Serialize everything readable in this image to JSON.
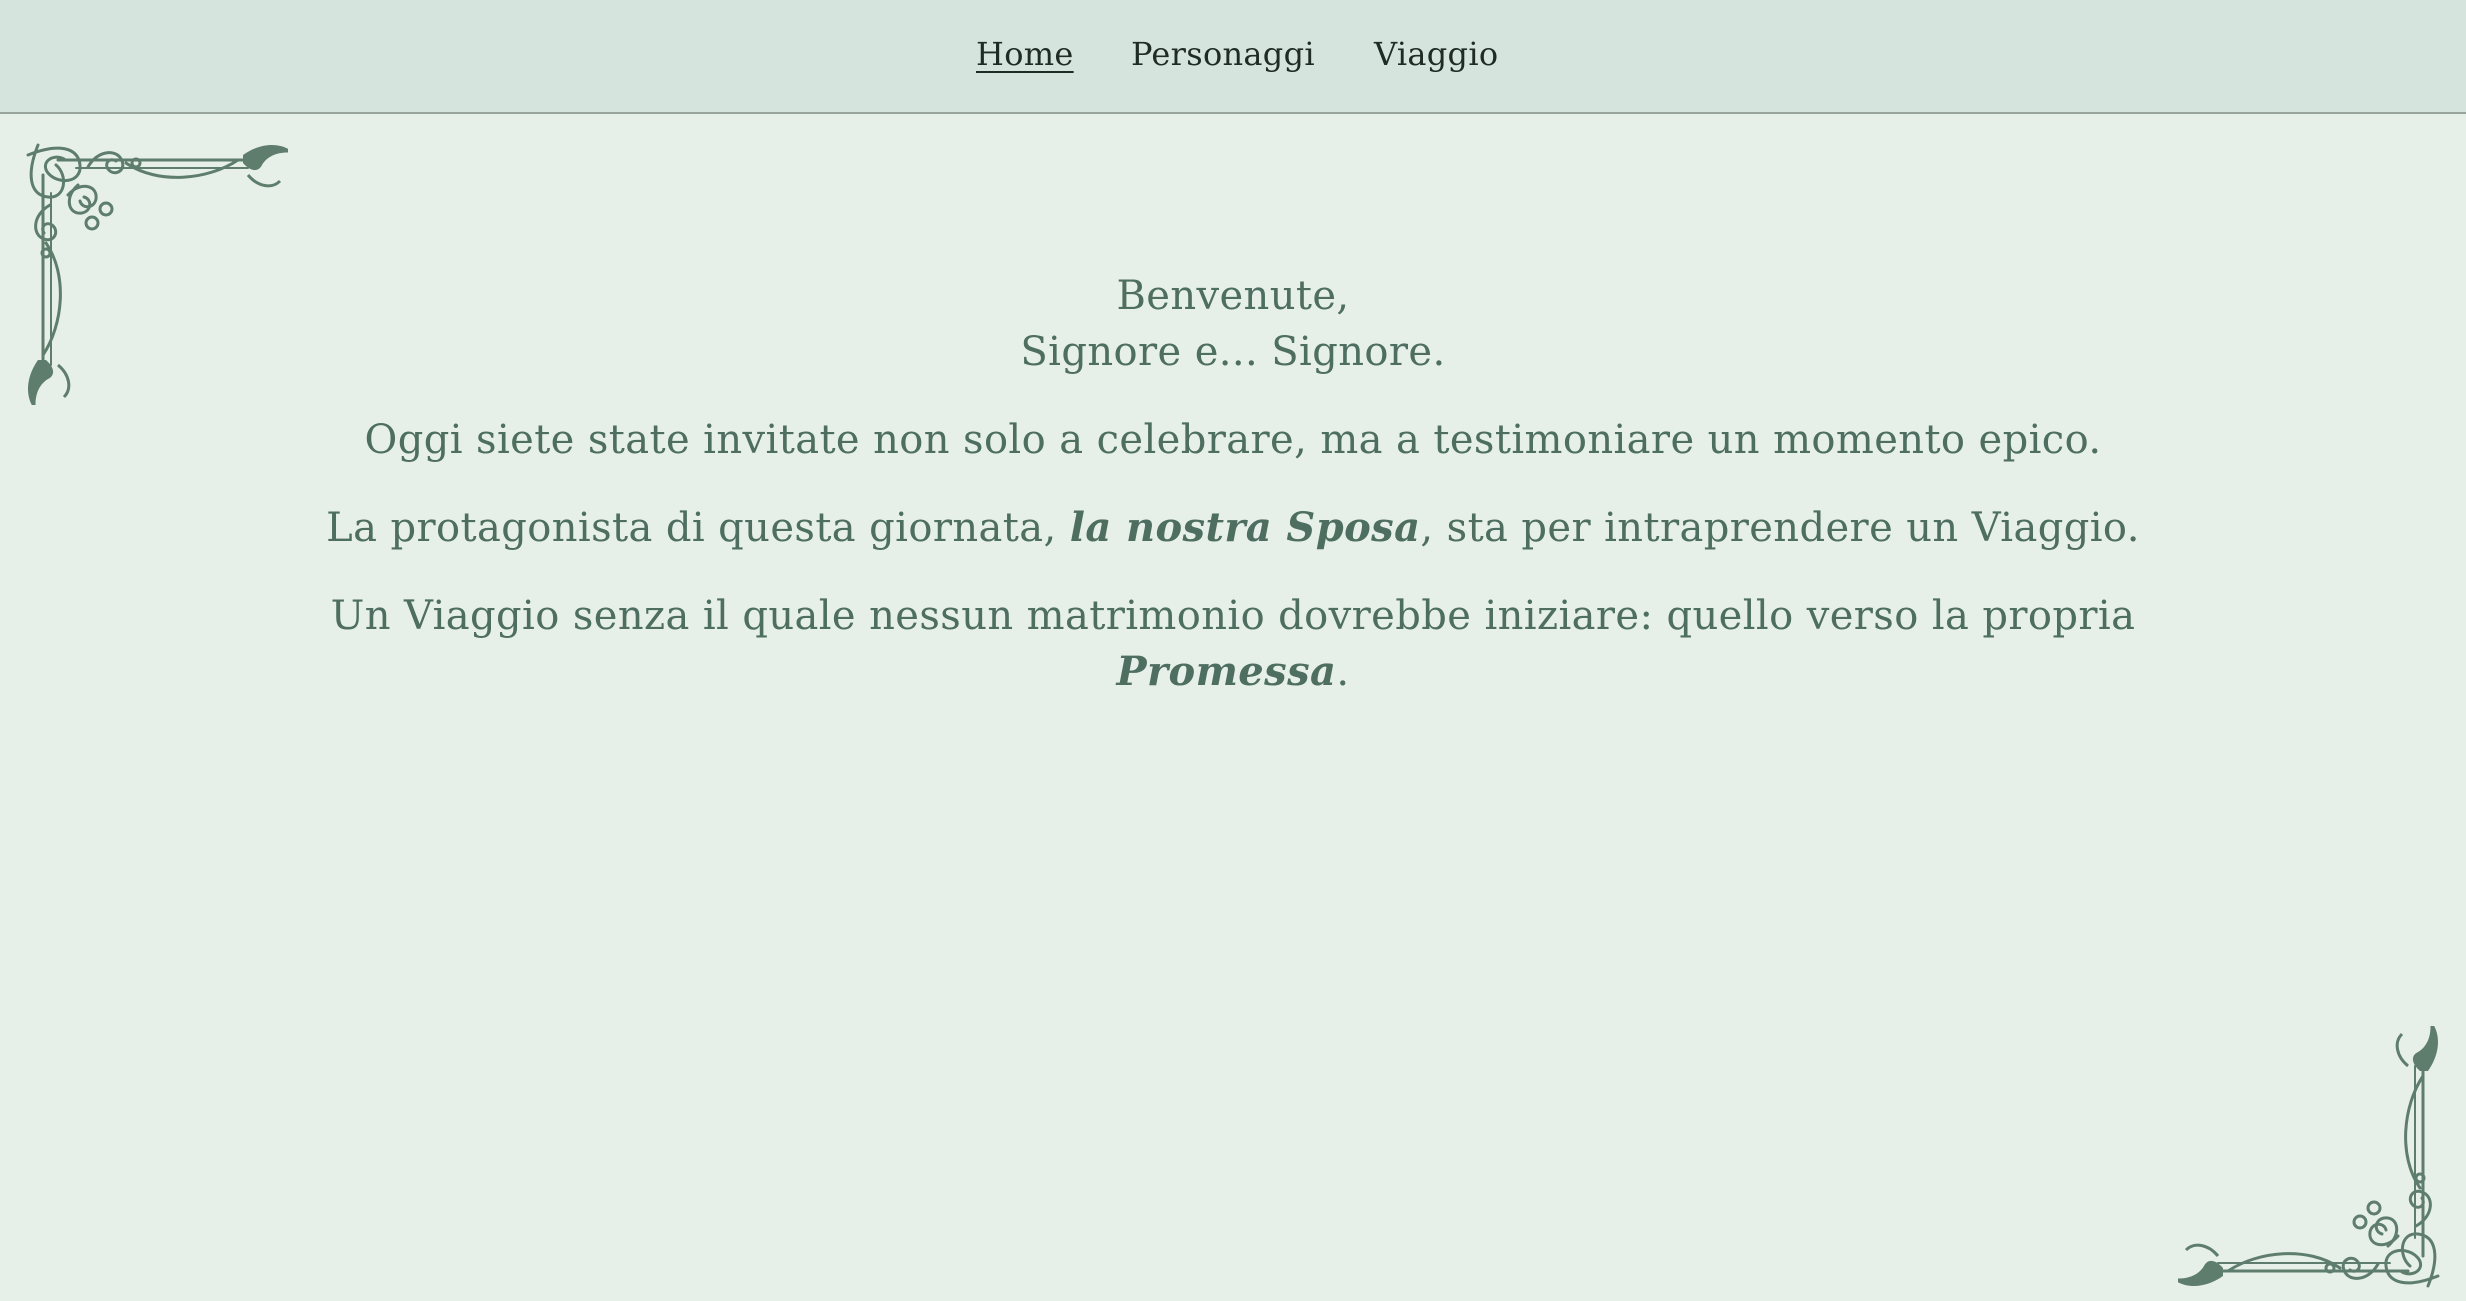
{
  "nav": {
    "items": [
      {
        "label": "Home",
        "active": true
      },
      {
        "label": "Personaggi",
        "active": false
      },
      {
        "label": "Viaggio",
        "active": false
      }
    ]
  },
  "welcome": {
    "line1": "Benvenute,",
    "line2": "Signore e... Signore."
  },
  "paragraphs": {
    "p1": "Oggi siete state invitate non solo a celebrare, ma a testimoniare un momento epico.",
    "p2_before": "La protagonista di questa giornata, ",
    "p2_emph": "la nostra Sposa",
    "p2_after": ", sta per intraprendere un Viaggio.",
    "p3_main": "Un Viaggio senza il quale nessun matrimonio dovrebbe iniziare: quello verso la propria",
    "p3_emph": "Promessa",
    "p3_end": "."
  },
  "ornaments": {
    "color": "#5e7d6c",
    "top_left_icon": "corner-flourish-icon",
    "bottom_right_icon": "corner-flourish-icon"
  },
  "colors": {
    "background": "#e6f0e8",
    "navbar": "#d5e4dc",
    "text": "#4d6e60",
    "nav_text": "#1f2b25"
  }
}
